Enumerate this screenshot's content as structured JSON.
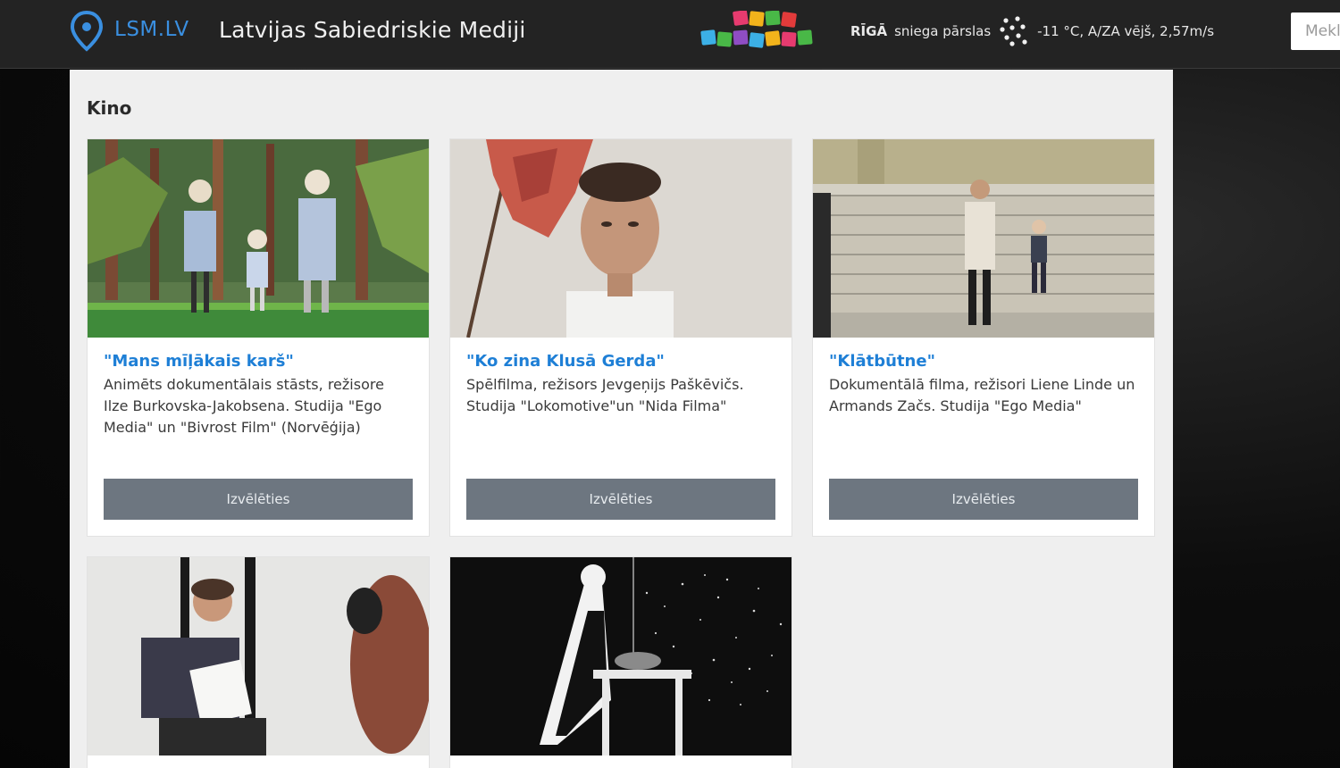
{
  "header": {
    "logo_text": "LSM.LV",
    "site_name": "Latvijas Sabiedriskie Mediji",
    "weather": {
      "city": "RĪGĀ",
      "condition": "sniega pārslas",
      "details": "-11 °C, A/ZA vējš, 2,57m/s"
    },
    "search_placeholder": "Meklēt"
  },
  "section": {
    "title": "Kino"
  },
  "cards": [
    {
      "title": "\"Mans mīļākais karš\"",
      "description": "Animēts dokumentālais stāsts, režisore Ilze Burkovska-Jakobsena. Studija \"Ego Media\" un \"Bivrost Film\" (Norvēģija)",
      "button": "Izvēlēties"
    },
    {
      "title": "\"Ko zina Klusā Gerda\"",
      "description": "Spēlfilma, režisors Jevgeņijs Paškēvičs. Studija \"Lokomotive\"un \"Nida Filma\"",
      "button": "Izvēlēties"
    },
    {
      "title": "\"Klātbūtne\"",
      "description": "Dokumentālā filma, režisori Liene Linde un Armands Začs. Studija \"Ego Media\"",
      "button": "Izvēlēties"
    },
    {
      "title": "",
      "description": "",
      "button": ""
    },
    {
      "title": "",
      "description": "",
      "button": ""
    }
  ],
  "colors": {
    "accent_blue": "#1e7fd6",
    "topbar": "#232323",
    "button_gray": "#6d7680",
    "panel": "#efefef"
  }
}
